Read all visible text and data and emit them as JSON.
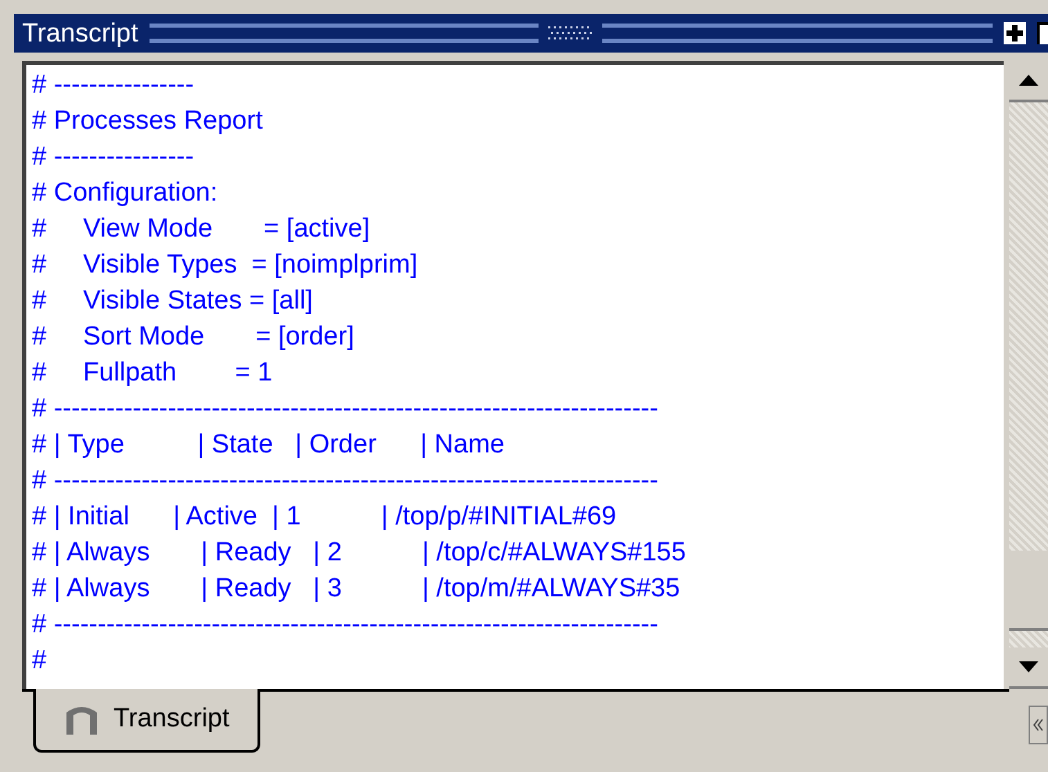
{
  "window": {
    "title": "Transcript"
  },
  "transcript": {
    "lines": [
      "# ----------------",
      "# Processes Report",
      "# ----------------",
      "# Configuration:",
      "#     View Mode       = [active]",
      "#     Visible Types  = [noimplprim]",
      "#     Visible States = [all]",
      "#     Sort Mode       = [order]",
      "#     Fullpath        = 1",
      "# ---------------------------------------------------------------------",
      "# | Type          | State   | Order      | Name",
      "# ---------------------------------------------------------------------",
      "# | Initial      | Active  | 1           | /top/p/#INITIAL#69",
      "# | Always       | Ready   | 2           | /top/c/#ALWAYS#155",
      "# | Always       | Ready   | 3           | /top/m/#ALWAYS#35",
      "# ---------------------------------------------------------------------",
      "#"
    ]
  },
  "tabs": [
    {
      "label": "Transcript",
      "selected": true
    }
  ]
}
